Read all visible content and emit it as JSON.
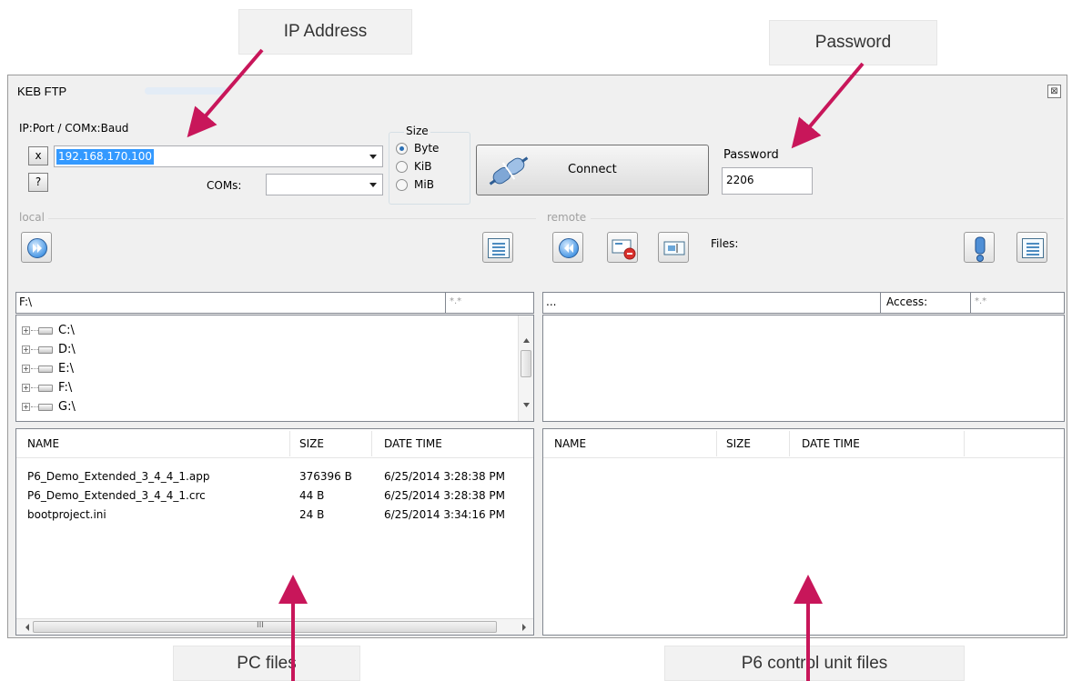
{
  "callouts": {
    "ip": "IP Address",
    "password": "Password",
    "pc_files": "PC files",
    "p6_files": "P6 control unit files"
  },
  "window": {
    "title": "KEB FTP",
    "close_glyph": "⊠"
  },
  "connection": {
    "ip_label": "IP:Port / COMx:Baud",
    "x_button": "x",
    "help_button": "?",
    "ip_value": "192.168.170.100",
    "coms_label": "COMs:",
    "coms_value": "",
    "size_label": "Size",
    "size_options": [
      "Byte",
      "KiB",
      "MiB"
    ],
    "size_selected": "Byte",
    "connect_label": "Connect",
    "password_label": "Password",
    "password_value": "2206"
  },
  "local": {
    "section_label": "local",
    "path": "F:\\",
    "mask": "*.*",
    "drives": [
      "C:\\",
      "D:\\",
      "E:\\",
      "F:\\",
      "G:\\"
    ],
    "columns": [
      "NAME",
      "SIZE",
      "DATE TIME"
    ],
    "files": [
      {
        "name": "P6_Demo_Extended_3_4_4_1.app",
        "size": "376396 B",
        "date": "6/25/2014 3:28:38 PM"
      },
      {
        "name": "P6_Demo_Extended_3_4_4_1.crc",
        "size": "44 B",
        "date": "6/25/2014 3:28:38 PM"
      },
      {
        "name": "bootproject.ini",
        "size": "24 B",
        "date": "6/25/2014 3:34:16 PM"
      }
    ],
    "hscroll_grip": "III"
  },
  "remote": {
    "section_label": "remote",
    "files_label": "Files:",
    "path": "...",
    "access_label": "Access:",
    "mask": "*.*",
    "columns": [
      "NAME",
      "SIZE",
      "DATE TIME"
    ],
    "files": []
  },
  "colors": {
    "arrow": "#c8165a",
    "selection": "#3399ff"
  }
}
